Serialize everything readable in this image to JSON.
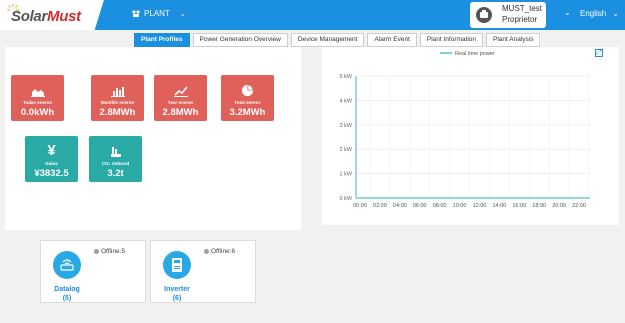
{
  "brand": {
    "solar": "Solar",
    "must": "Must"
  },
  "header": {
    "plant_icon": "plant-icon",
    "plant_label": "PLANT",
    "user_name": "MUST_test",
    "user_role": "Proprietor",
    "language": "English"
  },
  "tabs": [
    {
      "label": "Plant Profiles",
      "active": true
    },
    {
      "label": "Power Generation Overview"
    },
    {
      "label": "Device Management"
    },
    {
      "label": "Alarm Event"
    },
    {
      "label": "Plant Information"
    },
    {
      "label": "Plant Analysis"
    }
  ],
  "stats": [
    {
      "label": "Today energy",
      "value": "0.0kWh",
      "icon": "area-chart-icon",
      "color": "#e0605a"
    },
    {
      "label": "Monthly energy",
      "value": "2.8MWh",
      "icon": "bar-chart-icon",
      "color": "#e0605a"
    },
    {
      "label": "Year energy",
      "value": "2.8MWh",
      "icon": "line-chart-icon",
      "color": "#e0605a"
    },
    {
      "label": "Total energy",
      "value": "3.2MWh",
      "icon": "pie-chart-icon",
      "color": "#e0605a"
    },
    {
      "label": "Gains",
      "value": "¥3832.5",
      "icon": "yen-icon",
      "color": "#29aaa5"
    },
    {
      "label": "CO₂ reduced",
      "value": "3.2t",
      "icon": "factory-icon",
      "color": "#29aaa5"
    }
  ],
  "devices": [
    {
      "name": "Datalog",
      "count": "(5)",
      "status": "Offline:5",
      "icon": "router-icon"
    },
    {
      "name": "Inverter",
      "count": "(6)",
      "status": "Offline:6",
      "icon": "inverter-icon"
    }
  ],
  "chart_data": {
    "type": "line",
    "series": [
      {
        "name": "Real time power",
        "color": "#4fc3c0",
        "values": [
          0,
          0,
          0,
          0,
          0,
          0,
          0,
          0,
          0,
          0,
          0,
          0,
          0
        ]
      }
    ],
    "x": [
      "00:00",
      "02:00",
      "04:00",
      "06:00",
      "08:00",
      "10:00",
      "12:00",
      "14:00",
      "16:00",
      "18:00",
      "20:00",
      "22:00"
    ],
    "yticks": [
      "0 kW",
      "1 kW",
      "2 kW",
      "3 kW",
      "4 kW",
      "5 kW"
    ],
    "ylim": [
      0,
      5
    ],
    "legend": "top-center",
    "grid": true
  }
}
